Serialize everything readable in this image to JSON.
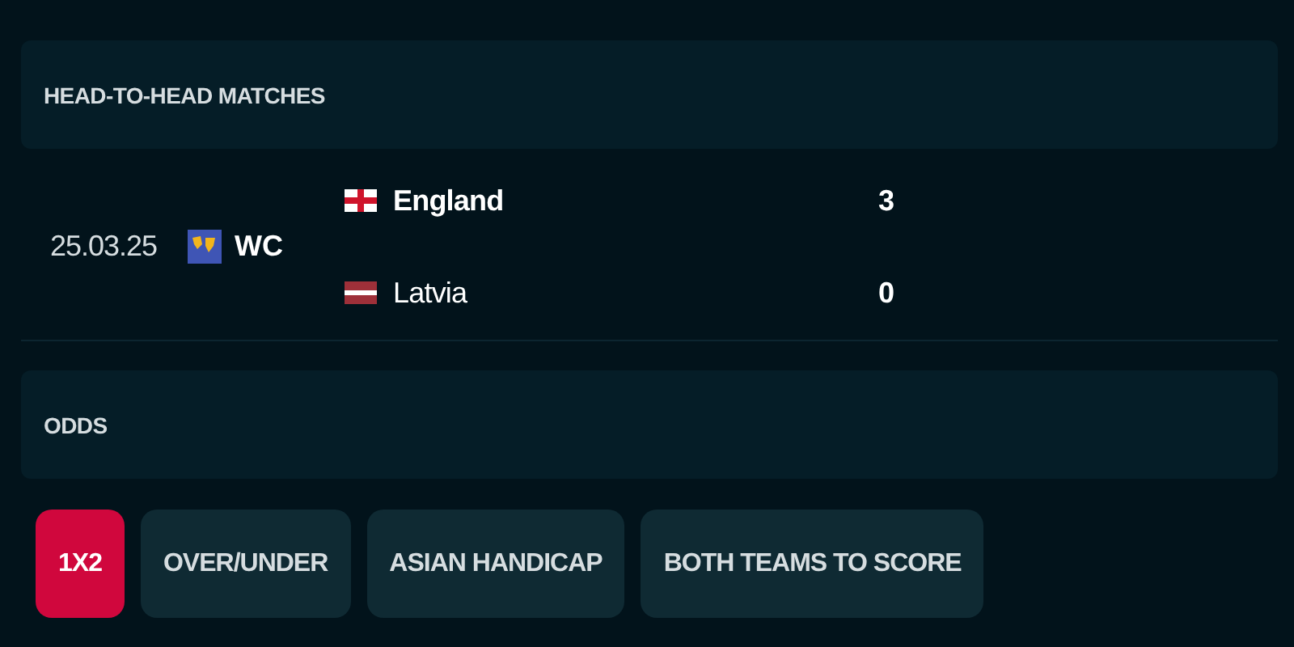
{
  "h2h": {
    "title": "HEAD-TO-HEAD MATCHES",
    "matches": [
      {
        "date": "25.03.25",
        "competition": "WC",
        "teams": [
          {
            "name": "England",
            "flag": {
              "kind": "england"
            },
            "winner": true,
            "score": "3"
          },
          {
            "name": "Latvia",
            "flag": {
              "kind": "latvia"
            },
            "winner": false,
            "score": "0"
          }
        ]
      }
    ]
  },
  "odds": {
    "title": "ODDS",
    "tabs": [
      {
        "label": "1X2",
        "selected": true
      },
      {
        "label": "OVER/UNDER",
        "selected": false
      },
      {
        "label": "ASIAN HANDICAP",
        "selected": false
      },
      {
        "label": "BOTH TEAMS TO SCORE",
        "selected": false
      }
    ]
  }
}
